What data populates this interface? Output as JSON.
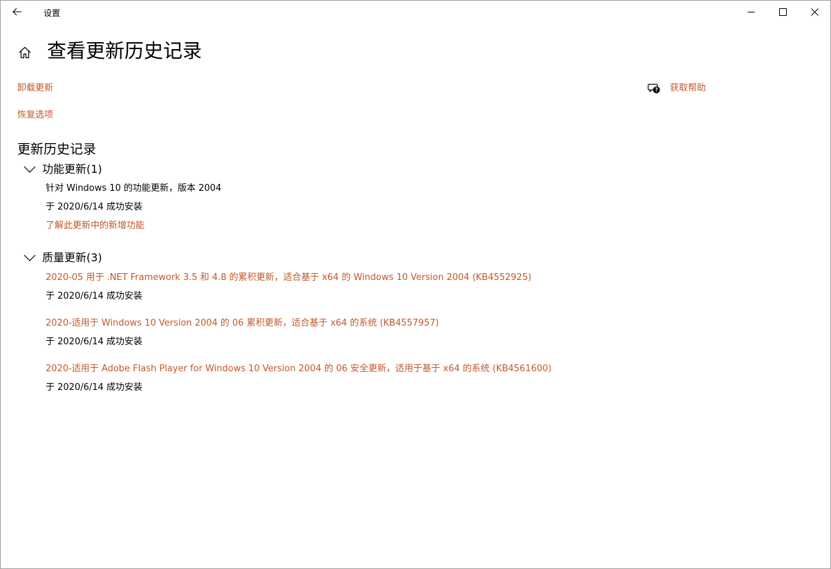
{
  "window": {
    "title": "设置"
  },
  "page": {
    "title": "查看更新历史记录"
  },
  "links": {
    "uninstall": "卸载更新",
    "recovery": "恢复选项",
    "help": "获取帮助"
  },
  "history": {
    "title": "更新历史记录",
    "feature_group": {
      "title": "功能更新(1)",
      "item_name": "针对 Windows 10 的功能更新，版本 2004",
      "item_status": "于 2020/6/14 成功安装",
      "learn_more": "了解此更新中的新增功能"
    },
    "quality_group": {
      "title": "质量更新(3)",
      "items": [
        {
          "name": "2020-05 用于 .NET Framework 3.5 和 4.8 的累积更新，适合基于 x64 的 Windows 10 Version 2004 (KB4552925)",
          "status": "于 2020/6/14 成功安装"
        },
        {
          "name": "2020-适用于 Windows 10 Version 2004 的 06 累积更新，适合基于 x64 的系统 (KB4557957)",
          "status": "于 2020/6/14 成功安装"
        },
        {
          "name": "2020-适用于 Adobe Flash Player for Windows 10 Version 2004 的 06 安全更新，适用于基于 x64 的系统 (KB4561600)",
          "status": "于 2020/6/14 成功安装"
        }
      ]
    }
  },
  "colors": {
    "accent_link": "#c2582a",
    "text": "#000000",
    "background": "#ffffff"
  },
  "icons": {
    "back": "back-arrow-icon",
    "minimize": "minimize-icon",
    "maximize": "maximize-icon",
    "close": "close-icon",
    "home": "home-icon",
    "help": "help-chat-icon",
    "expand": "chevron-down-icon"
  }
}
